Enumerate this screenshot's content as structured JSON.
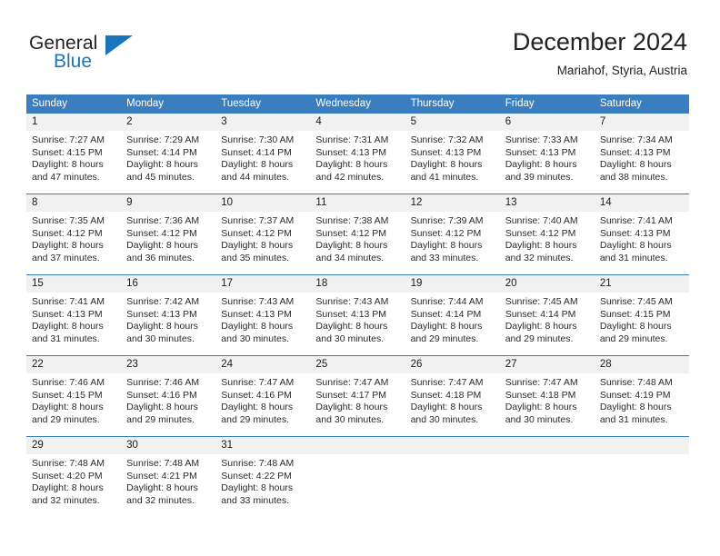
{
  "brand": {
    "name_part1": "General",
    "name_part2": "Blue",
    "accent_color": "#1b75bb"
  },
  "header": {
    "title": "December 2024",
    "subtitle": "Mariahof, Styria, Austria"
  },
  "theme": {
    "header_blue": "#3a7ebf",
    "daynum_gray": "#f1f1f1",
    "text": "#2a2a2a"
  },
  "weekdays": [
    "Sunday",
    "Monday",
    "Tuesday",
    "Wednesday",
    "Thursday",
    "Friday",
    "Saturday"
  ],
  "weeks": [
    [
      {
        "day": "1",
        "sunrise": "Sunrise: 7:27 AM",
        "sunset": "Sunset: 4:15 PM",
        "daylight1": "Daylight: 8 hours",
        "daylight2": "and 47 minutes."
      },
      {
        "day": "2",
        "sunrise": "Sunrise: 7:29 AM",
        "sunset": "Sunset: 4:14 PM",
        "daylight1": "Daylight: 8 hours",
        "daylight2": "and 45 minutes."
      },
      {
        "day": "3",
        "sunrise": "Sunrise: 7:30 AM",
        "sunset": "Sunset: 4:14 PM",
        "daylight1": "Daylight: 8 hours",
        "daylight2": "and 44 minutes."
      },
      {
        "day": "4",
        "sunrise": "Sunrise: 7:31 AM",
        "sunset": "Sunset: 4:13 PM",
        "daylight1": "Daylight: 8 hours",
        "daylight2": "and 42 minutes."
      },
      {
        "day": "5",
        "sunrise": "Sunrise: 7:32 AM",
        "sunset": "Sunset: 4:13 PM",
        "daylight1": "Daylight: 8 hours",
        "daylight2": "and 41 minutes."
      },
      {
        "day": "6",
        "sunrise": "Sunrise: 7:33 AM",
        "sunset": "Sunset: 4:13 PM",
        "daylight1": "Daylight: 8 hours",
        "daylight2": "and 39 minutes."
      },
      {
        "day": "7",
        "sunrise": "Sunrise: 7:34 AM",
        "sunset": "Sunset: 4:13 PM",
        "daylight1": "Daylight: 8 hours",
        "daylight2": "and 38 minutes."
      }
    ],
    [
      {
        "day": "8",
        "sunrise": "Sunrise: 7:35 AM",
        "sunset": "Sunset: 4:12 PM",
        "daylight1": "Daylight: 8 hours",
        "daylight2": "and 37 minutes."
      },
      {
        "day": "9",
        "sunrise": "Sunrise: 7:36 AM",
        "sunset": "Sunset: 4:12 PM",
        "daylight1": "Daylight: 8 hours",
        "daylight2": "and 36 minutes."
      },
      {
        "day": "10",
        "sunrise": "Sunrise: 7:37 AM",
        "sunset": "Sunset: 4:12 PM",
        "daylight1": "Daylight: 8 hours",
        "daylight2": "and 35 minutes."
      },
      {
        "day": "11",
        "sunrise": "Sunrise: 7:38 AM",
        "sunset": "Sunset: 4:12 PM",
        "daylight1": "Daylight: 8 hours",
        "daylight2": "and 34 minutes."
      },
      {
        "day": "12",
        "sunrise": "Sunrise: 7:39 AM",
        "sunset": "Sunset: 4:12 PM",
        "daylight1": "Daylight: 8 hours",
        "daylight2": "and 33 minutes."
      },
      {
        "day": "13",
        "sunrise": "Sunrise: 7:40 AM",
        "sunset": "Sunset: 4:12 PM",
        "daylight1": "Daylight: 8 hours",
        "daylight2": "and 32 minutes."
      },
      {
        "day": "14",
        "sunrise": "Sunrise: 7:41 AM",
        "sunset": "Sunset: 4:13 PM",
        "daylight1": "Daylight: 8 hours",
        "daylight2": "and 31 minutes."
      }
    ],
    [
      {
        "day": "15",
        "sunrise": "Sunrise: 7:41 AM",
        "sunset": "Sunset: 4:13 PM",
        "daylight1": "Daylight: 8 hours",
        "daylight2": "and 31 minutes."
      },
      {
        "day": "16",
        "sunrise": "Sunrise: 7:42 AM",
        "sunset": "Sunset: 4:13 PM",
        "daylight1": "Daylight: 8 hours",
        "daylight2": "and 30 minutes."
      },
      {
        "day": "17",
        "sunrise": "Sunrise: 7:43 AM",
        "sunset": "Sunset: 4:13 PM",
        "daylight1": "Daylight: 8 hours",
        "daylight2": "and 30 minutes."
      },
      {
        "day": "18",
        "sunrise": "Sunrise: 7:43 AM",
        "sunset": "Sunset: 4:13 PM",
        "daylight1": "Daylight: 8 hours",
        "daylight2": "and 30 minutes."
      },
      {
        "day": "19",
        "sunrise": "Sunrise: 7:44 AM",
        "sunset": "Sunset: 4:14 PM",
        "daylight1": "Daylight: 8 hours",
        "daylight2": "and 29 minutes."
      },
      {
        "day": "20",
        "sunrise": "Sunrise: 7:45 AM",
        "sunset": "Sunset: 4:14 PM",
        "daylight1": "Daylight: 8 hours",
        "daylight2": "and 29 minutes."
      },
      {
        "day": "21",
        "sunrise": "Sunrise: 7:45 AM",
        "sunset": "Sunset: 4:15 PM",
        "daylight1": "Daylight: 8 hours",
        "daylight2": "and 29 minutes."
      }
    ],
    [
      {
        "day": "22",
        "sunrise": "Sunrise: 7:46 AM",
        "sunset": "Sunset: 4:15 PM",
        "daylight1": "Daylight: 8 hours",
        "daylight2": "and 29 minutes."
      },
      {
        "day": "23",
        "sunrise": "Sunrise: 7:46 AM",
        "sunset": "Sunset: 4:16 PM",
        "daylight1": "Daylight: 8 hours",
        "daylight2": "and 29 minutes."
      },
      {
        "day": "24",
        "sunrise": "Sunrise: 7:47 AM",
        "sunset": "Sunset: 4:16 PM",
        "daylight1": "Daylight: 8 hours",
        "daylight2": "and 29 minutes."
      },
      {
        "day": "25",
        "sunrise": "Sunrise: 7:47 AM",
        "sunset": "Sunset: 4:17 PM",
        "daylight1": "Daylight: 8 hours",
        "daylight2": "and 30 minutes."
      },
      {
        "day": "26",
        "sunrise": "Sunrise: 7:47 AM",
        "sunset": "Sunset: 4:18 PM",
        "daylight1": "Daylight: 8 hours",
        "daylight2": "and 30 minutes."
      },
      {
        "day": "27",
        "sunrise": "Sunrise: 7:47 AM",
        "sunset": "Sunset: 4:18 PM",
        "daylight1": "Daylight: 8 hours",
        "daylight2": "and 30 minutes."
      },
      {
        "day": "28",
        "sunrise": "Sunrise: 7:48 AM",
        "sunset": "Sunset: 4:19 PM",
        "daylight1": "Daylight: 8 hours",
        "daylight2": "and 31 minutes."
      }
    ],
    [
      {
        "day": "29",
        "sunrise": "Sunrise: 7:48 AM",
        "sunset": "Sunset: 4:20 PM",
        "daylight1": "Daylight: 8 hours",
        "daylight2": "and 32 minutes."
      },
      {
        "day": "30",
        "sunrise": "Sunrise: 7:48 AM",
        "sunset": "Sunset: 4:21 PM",
        "daylight1": "Daylight: 8 hours",
        "daylight2": "and 32 minutes."
      },
      {
        "day": "31",
        "sunrise": "Sunrise: 7:48 AM",
        "sunset": "Sunset: 4:22 PM",
        "daylight1": "Daylight: 8 hours",
        "daylight2": "and 33 minutes."
      },
      {
        "day": "",
        "sunrise": "",
        "sunset": "",
        "daylight1": "",
        "daylight2": ""
      },
      {
        "day": "",
        "sunrise": "",
        "sunset": "",
        "daylight1": "",
        "daylight2": ""
      },
      {
        "day": "",
        "sunrise": "",
        "sunset": "",
        "daylight1": "",
        "daylight2": ""
      },
      {
        "day": "",
        "sunrise": "",
        "sunset": "",
        "daylight1": "",
        "daylight2": ""
      }
    ]
  ]
}
